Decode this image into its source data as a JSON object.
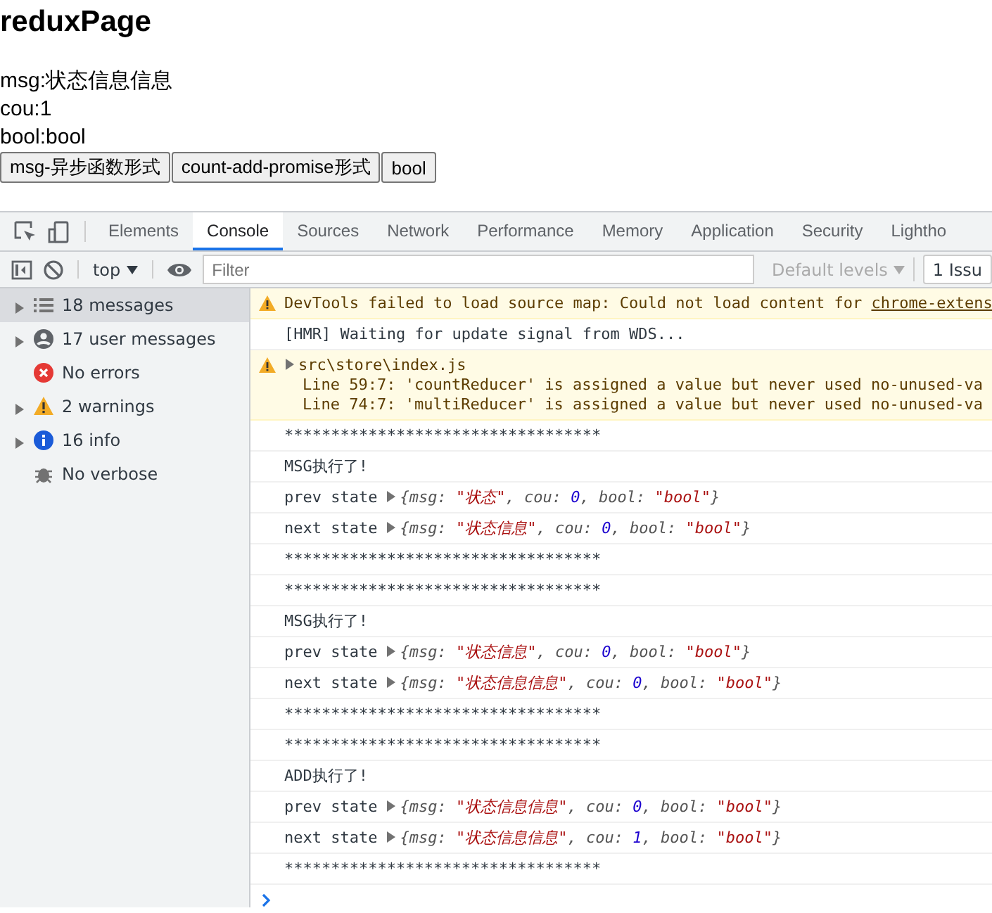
{
  "page": {
    "title": "reduxPage",
    "lines": [
      "msg:状态信息信息",
      "cou:1",
      "bool:bool"
    ],
    "buttons": [
      "msg-异步函数形式",
      "count-add-promise形式",
      "bool"
    ]
  },
  "devtools": {
    "tabs": [
      {
        "label": "Elements",
        "selected": false
      },
      {
        "label": "Console",
        "selected": true
      },
      {
        "label": "Sources",
        "selected": false
      },
      {
        "label": "Network",
        "selected": false
      },
      {
        "label": "Performance",
        "selected": false
      },
      {
        "label": "Memory",
        "selected": false
      },
      {
        "label": "Application",
        "selected": false
      },
      {
        "label": "Security",
        "selected": false
      },
      {
        "label": "Lightho",
        "selected": false
      }
    ],
    "toolbar": {
      "context": "top",
      "filter_placeholder": "Filter",
      "levels": "Default levels",
      "issues": "1 Issu"
    },
    "sidebar": [
      {
        "label": "18 messages",
        "kind": "list",
        "expanded": false,
        "selected": true
      },
      {
        "label": "17 user messages",
        "kind": "user",
        "expanded": false,
        "selected": false
      },
      {
        "label": "No errors",
        "kind": "error",
        "selected": false
      },
      {
        "label": "2 warnings",
        "kind": "warning",
        "expanded": false,
        "selected": false
      },
      {
        "label": "16 info",
        "kind": "info",
        "expanded": false,
        "selected": false
      },
      {
        "label": "No verbose",
        "kind": "verbose",
        "selected": false
      }
    ],
    "console": [
      {
        "kind": "warning",
        "text": "DevTools failed to load source map: Could not load content for ",
        "link": "chrome-extens"
      },
      {
        "kind": "log",
        "text": "[HMR] Waiting for update signal from WDS..."
      },
      {
        "kind": "group",
        "text": "src\\store\\index.js",
        "lines": [
          "Line 59:7:  'countReducer' is assigned a value but never used  no-unused-va",
          "Line 74:7:  'multiReducer' is assigned a value but never used  no-unused-va"
        ]
      },
      {
        "kind": "log",
        "text": "**********************************"
      },
      {
        "kind": "log",
        "text": "MSG执行了!"
      },
      {
        "kind": "state",
        "label": "prev state",
        "parts": [
          {
            "kind": "key",
            "text": "{msg: "
          },
          {
            "kind": "string",
            "text": "\"状态\""
          },
          {
            "kind": "key",
            "text": ", cou: "
          },
          {
            "kind": "number",
            "text": "0"
          },
          {
            "kind": "key",
            "text": ", bool: "
          },
          {
            "kind": "string",
            "text": "\"bool\""
          },
          {
            "kind": "key",
            "text": "}"
          }
        ]
      },
      {
        "kind": "state",
        "label": "next state",
        "parts": [
          {
            "kind": "key",
            "text": "{msg: "
          },
          {
            "kind": "string",
            "text": "\"状态信息\""
          },
          {
            "kind": "key",
            "text": ", cou: "
          },
          {
            "kind": "number",
            "text": "0"
          },
          {
            "kind": "key",
            "text": ", bool: "
          },
          {
            "kind": "string",
            "text": "\"bool\""
          },
          {
            "kind": "key",
            "text": "}"
          }
        ]
      },
      {
        "kind": "log",
        "text": "**********************************"
      },
      {
        "kind": "log",
        "text": "**********************************"
      },
      {
        "kind": "log",
        "text": "MSG执行了!"
      },
      {
        "kind": "state",
        "label": "prev state",
        "parts": [
          {
            "kind": "key",
            "text": "{msg: "
          },
          {
            "kind": "string",
            "text": "\"状态信息\""
          },
          {
            "kind": "key",
            "text": ", cou: "
          },
          {
            "kind": "number",
            "text": "0"
          },
          {
            "kind": "key",
            "text": ", bool: "
          },
          {
            "kind": "string",
            "text": "\"bool\""
          },
          {
            "kind": "key",
            "text": "}"
          }
        ]
      },
      {
        "kind": "state",
        "label": "next state",
        "parts": [
          {
            "kind": "key",
            "text": "{msg: "
          },
          {
            "kind": "string",
            "text": "\"状态信息信息\""
          },
          {
            "kind": "key",
            "text": ", cou: "
          },
          {
            "kind": "number",
            "text": "0"
          },
          {
            "kind": "key",
            "text": ", bool: "
          },
          {
            "kind": "string",
            "text": "\"bool\""
          },
          {
            "kind": "key",
            "text": "}"
          }
        ]
      },
      {
        "kind": "log",
        "text": "**********************************"
      },
      {
        "kind": "log",
        "text": "**********************************"
      },
      {
        "kind": "log",
        "text": "ADD执行了!"
      },
      {
        "kind": "state",
        "label": "prev state",
        "parts": [
          {
            "kind": "key",
            "text": "{msg: "
          },
          {
            "kind": "string",
            "text": "\"状态信息信息\""
          },
          {
            "kind": "key",
            "text": ", cou: "
          },
          {
            "kind": "number",
            "text": "0"
          },
          {
            "kind": "key",
            "text": ", bool: "
          },
          {
            "kind": "string",
            "text": "\"bool\""
          },
          {
            "kind": "key",
            "text": "}"
          }
        ]
      },
      {
        "kind": "state",
        "label": "next state",
        "parts": [
          {
            "kind": "key",
            "text": "{msg: "
          },
          {
            "kind": "string",
            "text": "\"状态信息信息\""
          },
          {
            "kind": "key",
            "text": ", cou: "
          },
          {
            "kind": "number",
            "text": "1"
          },
          {
            "kind": "key",
            "text": ", bool: "
          },
          {
            "kind": "string",
            "text": "\"bool\""
          },
          {
            "kind": "key",
            "text": "}"
          }
        ]
      },
      {
        "kind": "log",
        "text": "**********************************"
      }
    ]
  }
}
